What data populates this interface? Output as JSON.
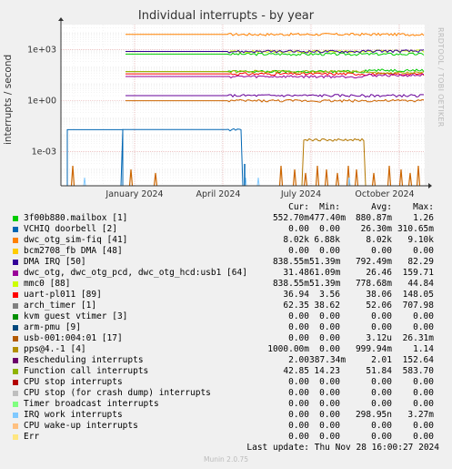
{
  "title": "Individual interrupts - by year",
  "watermark": "RRDTOOL / TOBI OETIKER",
  "footer": "Munin 2.0.75",
  "last_update": "Last update: Thu Nov 28 16:00:27 2024",
  "colors": {
    "background": "#f0f0f0",
    "plot_bg": "#ffffff",
    "grid_major": "#e0a0a0",
    "grid_minor": "#ececec"
  },
  "chart_data": {
    "type": "line",
    "title": "Individual interrupts - by year",
    "ylabel": "interrupts / second",
    "yscale": "log",
    "ylim": [
      1e-05,
      30000.0
    ],
    "y_ticks": [
      "1e+03",
      "1e+00",
      "1e-03"
    ],
    "x_ticks": [
      "January 2024",
      "April 2024",
      "July 2024",
      "October 2024"
    ],
    "grid": true,
    "series": [
      {
        "name": "3f00b880.mailbox [1]",
        "color": "#00cc00",
        "values": [
          552.7,
          552.7,
          552.7,
          552.7,
          552.7,
          552.7
        ]
      },
      {
        "name": "VCHIQ doorbell [2]",
        "color": "#0066b3",
        "values": [
          1e-05,
          0.02,
          0.02,
          1e-05,
          1e-05,
          1e-05
        ]
      },
      {
        "name": "dwc_otg_sim-fiq [41]",
        "color": "#ff8000",
        "values": [
          8020,
          8020,
          8020,
          8020,
          8020,
          8020
        ]
      },
      {
        "name": "mmc0 [88]",
        "color": "#ccff00",
        "values": [
          838.55,
          778.68,
          778.68,
          778.68,
          778.68,
          838.55
        ]
      },
      {
        "name": "uart-pl011 [89]",
        "color": "#ff0000",
        "values": [
          36.94,
          38.06,
          38.06,
          38.06,
          38.06,
          36.94
        ]
      },
      {
        "name": "arch_timer [1]",
        "color": "#00cc00",
        "values": [
          62.35,
          52.06,
          52.06,
          52.06,
          52.06,
          62.35
        ]
      },
      {
        "name": "DMA IRQ [50]",
        "color": "#330099",
        "values": [
          838.55,
          792.49,
          792.49,
          792.49,
          792.49,
          838.55
        ]
      },
      {
        "name": "Function call interrupts",
        "color": "#aaaa00",
        "values": [
          42.85,
          51.84,
          51.84,
          51.84,
          51.84,
          42.85
        ]
      },
      {
        "name": "dwc_otg, dwc_otg_pcd, dwc_otg_hcd:usb1 [64]",
        "color": "#990099",
        "values": [
          31.48,
          26.46,
          26.46,
          26.46,
          26.46,
          31.48
        ]
      },
      {
        "name": "Rescheduling interrupts",
        "color": "#660099",
        "values": [
          2.0,
          2.01,
          2.01,
          2.01,
          2.01,
          2.0
        ]
      },
      {
        "name": "pps@4.-1 [4]",
        "color": "#cc6600",
        "values": [
          1.0,
          0.99994,
          0.99994,
          0.99994,
          0.99994,
          1.0
        ]
      },
      {
        "name": "usb-001:004:01 [17]",
        "color": "#b37700",
        "values": [
          1e-05,
          1e-05,
          1e-05,
          1e-05,
          0.005,
          1e-05
        ]
      }
    ],
    "legend_headers": [
      "Cur:",
      "Min:",
      "Avg:",
      "Max:"
    ],
    "legend": [
      {
        "color": "#00cc00",
        "name": "3f00b880.mailbox [1]",
        "cur": "552.70m",
        "min": "477.40m",
        "avg": "880.87m",
        "max": "1.26"
      },
      {
        "color": "#0066b3",
        "name": "VCHIQ doorbell [2]",
        "cur": "0.00",
        "min": "0.00",
        "avg": "26.30m",
        "max": "310.65m"
      },
      {
        "color": "#ff8000",
        "name": "dwc_otg_sim-fiq [41]",
        "cur": "8.02k",
        "min": "6.88k",
        "avg": "8.02k",
        "max": "9.10k"
      },
      {
        "color": "#ffcc00",
        "name": "bcm2708_fb DMA [48]",
        "cur": "0.00",
        "min": "0.00",
        "avg": "0.00",
        "max": "0.00"
      },
      {
        "color": "#330099",
        "name": "DMA IRQ [50]",
        "cur": "838.55m",
        "min": "51.39m",
        "avg": "792.49m",
        "max": "82.29"
      },
      {
        "color": "#990099",
        "name": "dwc_otg, dwc_otg_pcd, dwc_otg_hcd:usb1 [64]",
        "cur": "31.48",
        "min": "61.09m",
        "avg": "26.46",
        "max": "159.71"
      },
      {
        "color": "#ccff00",
        "name": "mmc0 [88]",
        "cur": "838.55m",
        "min": "51.39m",
        "avg": "778.68m",
        "max": "44.84"
      },
      {
        "color": "#ff0000",
        "name": "uart-pl011 [89]",
        "cur": "36.94",
        "min": "3.56",
        "avg": "38.06",
        "max": "148.05"
      },
      {
        "color": "#808080",
        "name": "arch_timer [1]",
        "cur": "62.35",
        "min": "38.62",
        "avg": "52.06",
        "max": "707.98"
      },
      {
        "color": "#008f00",
        "name": "kvm guest vtimer [3]",
        "cur": "0.00",
        "min": "0.00",
        "avg": "0.00",
        "max": "0.00"
      },
      {
        "color": "#00487d",
        "name": "arm-pmu [9]",
        "cur": "0.00",
        "min": "0.00",
        "avg": "0.00",
        "max": "0.00"
      },
      {
        "color": "#b35a00",
        "name": "usb-001:004:01 [17]",
        "cur": "0.00",
        "min": "0.00",
        "avg": "3.12u",
        "max": "26.31m"
      },
      {
        "color": "#b38f00",
        "name": "pps@4.-1 [4]",
        "cur": "1000.00m",
        "min": "0.00",
        "avg": "999.94m",
        "max": "1.14"
      },
      {
        "color": "#6b006b",
        "name": "Rescheduling interrupts",
        "cur": "2.00",
        "min": "387.34m",
        "avg": "2.01",
        "max": "152.64"
      },
      {
        "color": "#8fb300",
        "name": "Function call interrupts",
        "cur": "42.85",
        "min": "14.23",
        "avg": "51.84",
        "max": "583.70"
      },
      {
        "color": "#b30000",
        "name": "CPU stop interrupts",
        "cur": "0.00",
        "min": "0.00",
        "avg": "0.00",
        "max": "0.00"
      },
      {
        "color": "#bebebe",
        "name": "CPU stop (for crash dump) interrupts",
        "cur": "0.00",
        "min": "0.00",
        "avg": "0.00",
        "max": "0.00"
      },
      {
        "color": "#80ff80",
        "name": "Timer broadcast interrupts",
        "cur": "0.00",
        "min": "0.00",
        "avg": "0.00",
        "max": "0.00"
      },
      {
        "color": "#80c9ff",
        "name": "IRQ work interrupts",
        "cur": "0.00",
        "min": "0.00",
        "avg": "298.95n",
        "max": "3.27m"
      },
      {
        "color": "#ffc080",
        "name": "CPU wake-up interrupts",
        "cur": "0.00",
        "min": "0.00",
        "avg": "0.00",
        "max": "0.00"
      },
      {
        "color": "#ffe680",
        "name": "Err",
        "cur": "0.00",
        "min": "0.00",
        "avg": "0.00",
        "max": "0.00"
      }
    ]
  }
}
